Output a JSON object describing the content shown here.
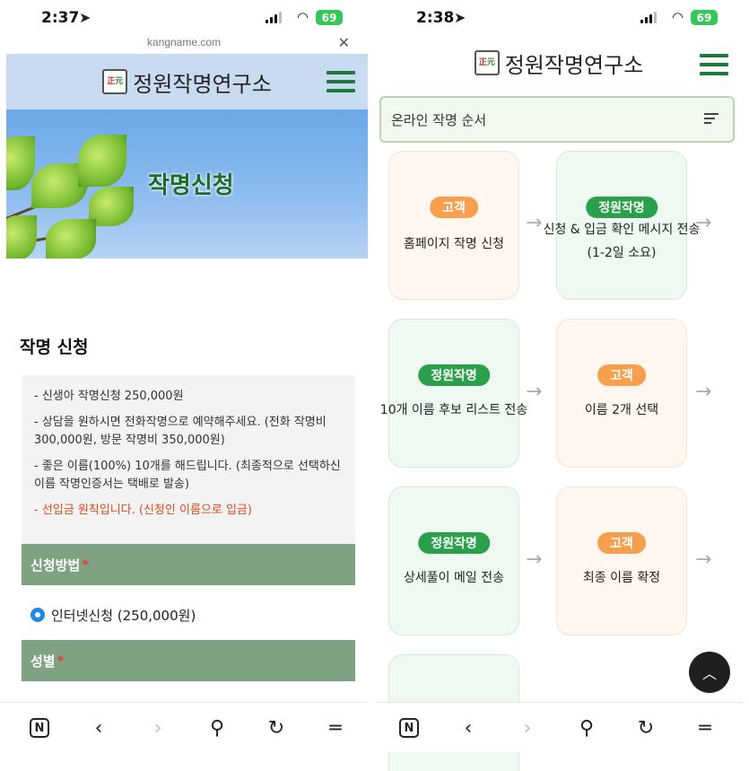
{
  "left": {
    "status": {
      "time": "2:37",
      "battery": "69"
    },
    "url": "kangname.com",
    "header": {
      "brand": "정원작명연구소",
      "logo_top": "正",
      "logo_bottom": "元"
    },
    "hero_title": "작명신청",
    "section_title": "작명 신청",
    "notice": [
      "- 신생아 작명신청 250,000원",
      "- 상담을 원하시면 전화작명으로 예약해주세요. (전화 작명비 300,000원, 방문 작명비 350,000원)",
      "- 좋은 이름(100%) 10개를 해드립니다. (최종적으로 선택하신 이름 작명인증서는 택배로 발송)",
      "- 선입금 원칙입니다. (신청인 이름으로 입금)"
    ],
    "form": {
      "method_label": "신청방법",
      "method_option": "인터넷신청 (250,000원)",
      "gender_label": "성별",
      "required_mark": "*"
    }
  },
  "right": {
    "status": {
      "time": "2:38",
      "battery": "69"
    },
    "header": {
      "brand": "정원작명연구소",
      "logo_top": "正",
      "logo_bottom": "元"
    },
    "steps_title": "온라인 작명 순서",
    "steps": [
      {
        "badge": "고객",
        "text": "홈페이지 작명 신청"
      },
      {
        "badge": "정원작명",
        "text": "신청 & 입금 확인 메시지 전송 (1-2일 소요)"
      },
      {
        "badge": "정원작명",
        "text": "10개 이름 후보 리스트 전송"
      },
      {
        "badge": "고객",
        "text": "이름 2개 선택"
      },
      {
        "badge": "정원작명",
        "text": "상세풀이 메일 전송"
      },
      {
        "badge": "고객",
        "text": "최종 이름 확정"
      }
    ]
  },
  "toolbar": {
    "n_label": "N"
  },
  "colors": {
    "brand_green": "#1d7a3a",
    "form_bar": "#7fa382",
    "badge_orange": "#f6a04d",
    "badge_green": "#2aa04a",
    "notice_red": "#e04a1c"
  }
}
